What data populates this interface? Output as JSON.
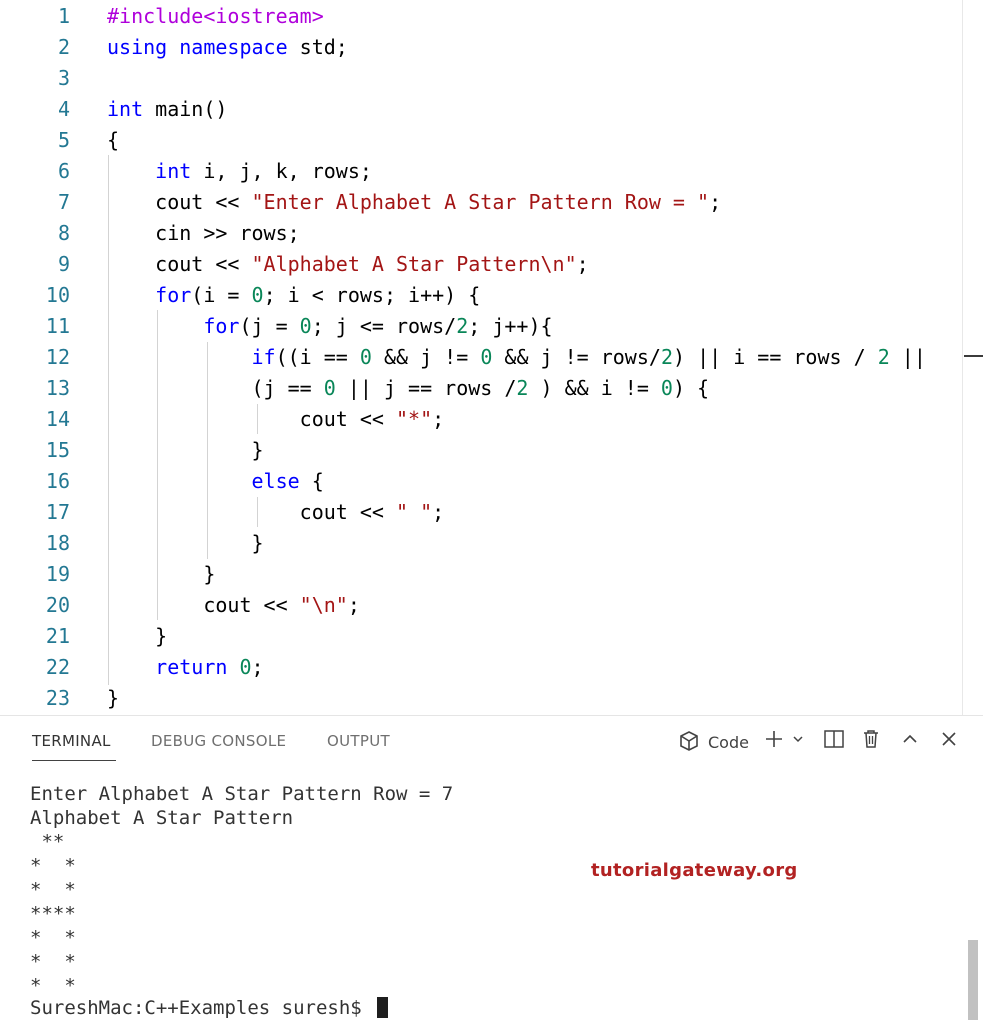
{
  "editor": {
    "lines": [
      {
        "n": "1",
        "t": [
          [
            "#include<iostream>",
            "pp"
          ]
        ]
      },
      {
        "n": "2",
        "t": [
          [
            "using namespace",
            "kw"
          ],
          [
            " std;",
            "p"
          ]
        ]
      },
      {
        "n": "3",
        "t": []
      },
      {
        "n": "4",
        "t": [
          [
            "int",
            "kw"
          ],
          [
            " main()",
            "p"
          ]
        ]
      },
      {
        "n": "5",
        "t": [
          [
            "{",
            "p"
          ]
        ]
      },
      {
        "n": "6",
        "t": [
          [
            "    ",
            "p"
          ],
          [
            "int",
            "kw"
          ],
          [
            " i, j, k, rows;",
            "p"
          ]
        ]
      },
      {
        "n": "7",
        "t": [
          [
            "    cout << ",
            "p"
          ],
          [
            "\"Enter Alphabet A Star Pattern Row = \"",
            "str"
          ],
          [
            ";",
            "p"
          ]
        ]
      },
      {
        "n": "8",
        "t": [
          [
            "    cin >> rows;",
            "p"
          ]
        ]
      },
      {
        "n": "9",
        "t": [
          [
            "    cout << ",
            "p"
          ],
          [
            "\"Alphabet A Star Pattern\\n\"",
            "str"
          ],
          [
            ";",
            "p"
          ]
        ]
      },
      {
        "n": "10",
        "t": [
          [
            "    ",
            "p"
          ],
          [
            "for",
            "kw"
          ],
          [
            "(i = ",
            "p"
          ],
          [
            "0",
            "num"
          ],
          [
            "; i < rows; i++) {",
            "p"
          ]
        ]
      },
      {
        "n": "11",
        "t": [
          [
            "        ",
            "p"
          ],
          [
            "for",
            "kw"
          ],
          [
            "(j = ",
            "p"
          ],
          [
            "0",
            "num"
          ],
          [
            "; j <= rows/",
            "p"
          ],
          [
            "2",
            "num"
          ],
          [
            "; j++){",
            "p"
          ]
        ]
      },
      {
        "n": "12",
        "t": [
          [
            "            ",
            "p"
          ],
          [
            "if",
            "kw"
          ],
          [
            "((i == ",
            "p"
          ],
          [
            "0",
            "num"
          ],
          [
            " && j != ",
            "p"
          ],
          [
            "0",
            "num"
          ],
          [
            " && j != rows/",
            "p"
          ],
          [
            "2",
            "num"
          ],
          [
            ") || i == rows / ",
            "p"
          ],
          [
            "2",
            "num"
          ],
          [
            " ||",
            "p"
          ]
        ]
      },
      {
        "n": "13",
        "t": [
          [
            "            (j == ",
            "p"
          ],
          [
            "0",
            "num"
          ],
          [
            " || j == rows /",
            "p"
          ],
          [
            "2",
            "num"
          ],
          [
            " ) && i != ",
            "p"
          ],
          [
            "0",
            "num"
          ],
          [
            ") {",
            "p"
          ]
        ]
      },
      {
        "n": "14",
        "t": [
          [
            "                cout << ",
            "p"
          ],
          [
            "\"*\"",
            "str"
          ],
          [
            ";",
            "p"
          ]
        ]
      },
      {
        "n": "15",
        "t": [
          [
            "            }",
            "p"
          ]
        ]
      },
      {
        "n": "16",
        "t": [
          [
            "            ",
            "p"
          ],
          [
            "else",
            "kw"
          ],
          [
            " {",
            "p"
          ]
        ]
      },
      {
        "n": "17",
        "t": [
          [
            "                cout << ",
            "p"
          ],
          [
            "\" \"",
            "str"
          ],
          [
            ";",
            "p"
          ]
        ]
      },
      {
        "n": "18",
        "t": [
          [
            "            }",
            "p"
          ]
        ]
      },
      {
        "n": "19",
        "t": [
          [
            "        }",
            "p"
          ]
        ]
      },
      {
        "n": "20",
        "t": [
          [
            "        cout << ",
            "p"
          ],
          [
            "\"\\n\"",
            "str"
          ],
          [
            ";",
            "p"
          ]
        ]
      },
      {
        "n": "21",
        "t": [
          [
            "    }",
            "p"
          ]
        ]
      },
      {
        "n": "22",
        "t": [
          [
            "    ",
            "p"
          ],
          [
            "return",
            "kw"
          ],
          [
            " ",
            "p"
          ],
          [
            "0",
            "num"
          ],
          [
            ";",
            "p"
          ]
        ]
      },
      {
        "n": "23",
        "t": [
          [
            "}",
            "p"
          ]
        ]
      }
    ],
    "colors": {
      "kw": "#0000ff",
      "str": "#a31515",
      "num": "#098658",
      "pp": "#af00db",
      "p": "#000000",
      "line_number": "#237893"
    }
  },
  "panel": {
    "tabs": [
      "TERMINAL",
      "DEBUG CONSOLE",
      "OUTPUT"
    ],
    "active_tab": "TERMINAL",
    "shell_label": "Code",
    "icons": [
      "terminal-shell-icon",
      "add-icon",
      "chevron-down-icon",
      "split-icon",
      "trash-icon",
      "maximize-icon",
      "close-icon"
    ]
  },
  "terminal": {
    "lines": [
      "Enter Alphabet A Star Pattern Row = 7",
      "Alphabet A Star Pattern",
      " **",
      "*  *",
      "*  *",
      "****",
      "*  *",
      "*  *",
      "*  *"
    ],
    "prompt": "SureshMac:C++Examples suresh$ "
  },
  "watermark": "tutorialgateway.org"
}
